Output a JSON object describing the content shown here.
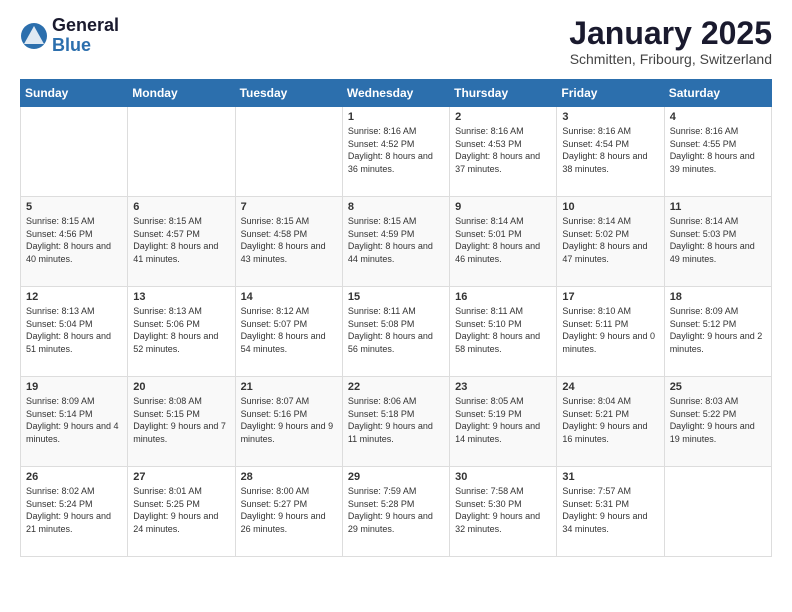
{
  "logo": {
    "general": "General",
    "blue": "Blue"
  },
  "header": {
    "month": "January 2025",
    "location": "Schmitten, Fribourg, Switzerland"
  },
  "weekdays": [
    "Sunday",
    "Monday",
    "Tuesday",
    "Wednesday",
    "Thursday",
    "Friday",
    "Saturday"
  ],
  "weeks": [
    [
      null,
      null,
      null,
      {
        "day": 1,
        "sunrise": "8:16 AM",
        "sunset": "4:52 PM",
        "daylight": "8 hours and 36 minutes."
      },
      {
        "day": 2,
        "sunrise": "8:16 AM",
        "sunset": "4:53 PM",
        "daylight": "8 hours and 37 minutes."
      },
      {
        "day": 3,
        "sunrise": "8:16 AM",
        "sunset": "4:54 PM",
        "daylight": "8 hours and 38 minutes."
      },
      {
        "day": 4,
        "sunrise": "8:16 AM",
        "sunset": "4:55 PM",
        "daylight": "8 hours and 39 minutes."
      }
    ],
    [
      {
        "day": 5,
        "sunrise": "8:15 AM",
        "sunset": "4:56 PM",
        "daylight": "8 hours and 40 minutes."
      },
      {
        "day": 6,
        "sunrise": "8:15 AM",
        "sunset": "4:57 PM",
        "daylight": "8 hours and 41 minutes."
      },
      {
        "day": 7,
        "sunrise": "8:15 AM",
        "sunset": "4:58 PM",
        "daylight": "8 hours and 43 minutes."
      },
      {
        "day": 8,
        "sunrise": "8:15 AM",
        "sunset": "4:59 PM",
        "daylight": "8 hours and 44 minutes."
      },
      {
        "day": 9,
        "sunrise": "8:14 AM",
        "sunset": "5:01 PM",
        "daylight": "8 hours and 46 minutes."
      },
      {
        "day": 10,
        "sunrise": "8:14 AM",
        "sunset": "5:02 PM",
        "daylight": "8 hours and 47 minutes."
      },
      {
        "day": 11,
        "sunrise": "8:14 AM",
        "sunset": "5:03 PM",
        "daylight": "8 hours and 49 minutes."
      }
    ],
    [
      {
        "day": 12,
        "sunrise": "8:13 AM",
        "sunset": "5:04 PM",
        "daylight": "8 hours and 51 minutes."
      },
      {
        "day": 13,
        "sunrise": "8:13 AM",
        "sunset": "5:06 PM",
        "daylight": "8 hours and 52 minutes."
      },
      {
        "day": 14,
        "sunrise": "8:12 AM",
        "sunset": "5:07 PM",
        "daylight": "8 hours and 54 minutes."
      },
      {
        "day": 15,
        "sunrise": "8:11 AM",
        "sunset": "5:08 PM",
        "daylight": "8 hours and 56 minutes."
      },
      {
        "day": 16,
        "sunrise": "8:11 AM",
        "sunset": "5:10 PM",
        "daylight": "8 hours and 58 minutes."
      },
      {
        "day": 17,
        "sunrise": "8:10 AM",
        "sunset": "5:11 PM",
        "daylight": "9 hours and 0 minutes."
      },
      {
        "day": 18,
        "sunrise": "8:09 AM",
        "sunset": "5:12 PM",
        "daylight": "9 hours and 2 minutes."
      }
    ],
    [
      {
        "day": 19,
        "sunrise": "8:09 AM",
        "sunset": "5:14 PM",
        "daylight": "9 hours and 4 minutes."
      },
      {
        "day": 20,
        "sunrise": "8:08 AM",
        "sunset": "5:15 PM",
        "daylight": "9 hours and 7 minutes."
      },
      {
        "day": 21,
        "sunrise": "8:07 AM",
        "sunset": "5:16 PM",
        "daylight": "9 hours and 9 minutes."
      },
      {
        "day": 22,
        "sunrise": "8:06 AM",
        "sunset": "5:18 PM",
        "daylight": "9 hours and 11 minutes."
      },
      {
        "day": 23,
        "sunrise": "8:05 AM",
        "sunset": "5:19 PM",
        "daylight": "9 hours and 14 minutes."
      },
      {
        "day": 24,
        "sunrise": "8:04 AM",
        "sunset": "5:21 PM",
        "daylight": "9 hours and 16 minutes."
      },
      {
        "day": 25,
        "sunrise": "8:03 AM",
        "sunset": "5:22 PM",
        "daylight": "9 hours and 19 minutes."
      }
    ],
    [
      {
        "day": 26,
        "sunrise": "8:02 AM",
        "sunset": "5:24 PM",
        "daylight": "9 hours and 21 minutes."
      },
      {
        "day": 27,
        "sunrise": "8:01 AM",
        "sunset": "5:25 PM",
        "daylight": "9 hours and 24 minutes."
      },
      {
        "day": 28,
        "sunrise": "8:00 AM",
        "sunset": "5:27 PM",
        "daylight": "9 hours and 26 minutes."
      },
      {
        "day": 29,
        "sunrise": "7:59 AM",
        "sunset": "5:28 PM",
        "daylight": "9 hours and 29 minutes."
      },
      {
        "day": 30,
        "sunrise": "7:58 AM",
        "sunset": "5:30 PM",
        "daylight": "9 hours and 32 minutes."
      },
      {
        "day": 31,
        "sunrise": "7:57 AM",
        "sunset": "5:31 PM",
        "daylight": "9 hours and 34 minutes."
      },
      null
    ]
  ]
}
